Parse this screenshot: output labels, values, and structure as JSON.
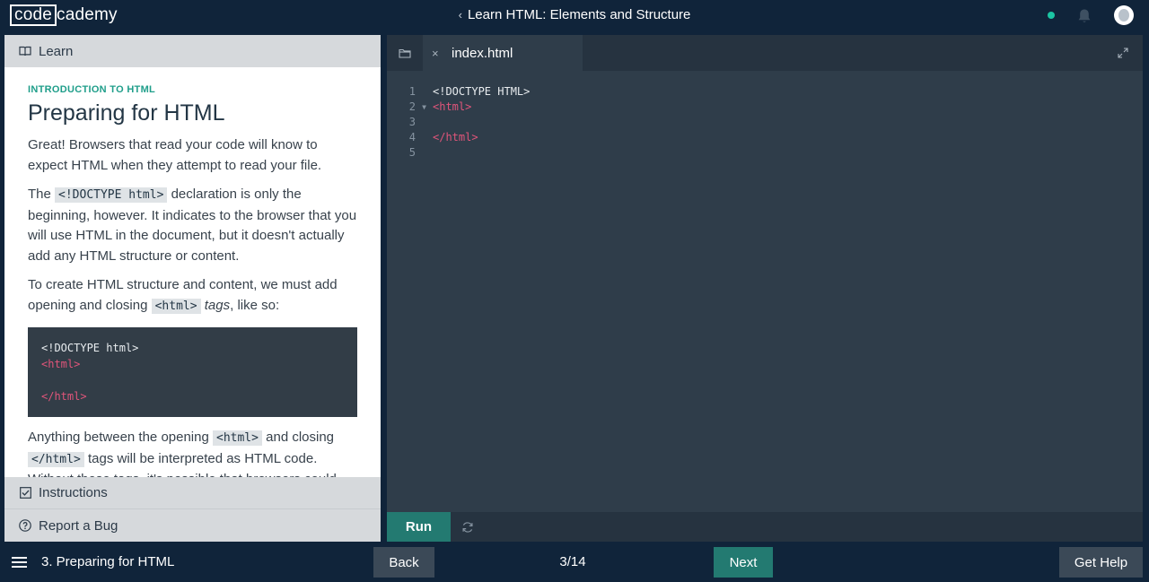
{
  "header": {
    "logo_left": "code",
    "logo_right": "cademy",
    "course_title": "Learn HTML: Elements and Structure",
    "back_chevron": "‹",
    "icons": {
      "status": "online-dot",
      "notifications": "bell-icon",
      "profile": "avatar"
    }
  },
  "colors": {
    "accent": "#1f9e8a",
    "run": "#237a71",
    "background": "#10243a",
    "editor": "#2f3d4a",
    "tag": "#e0557a"
  },
  "learn_panel": {
    "tab_label": "Learn",
    "eyebrow": "INTRODUCTION TO HTML",
    "title": "Preparing for HTML",
    "p1": "Great! Browsers that read your code will know to expect HTML when they attempt to read your file.",
    "p2_pre": "The ",
    "p2_code": "<!DOCTYPE html>",
    "p2_post": " declaration is only the beginning, however. It indicates to the browser that you will use HTML in the document, but it doesn't actually add any HTML structure or content.",
    "p3_pre": "To create HTML structure and content, we must add opening and closing ",
    "p3_code": "<html>",
    "p3_em": "tags",
    "p3_post": ", like so:",
    "codeblock": {
      "line1": "<!DOCTYPE html>",
      "line2": "<html>",
      "line3": "",
      "line4": "</html>"
    },
    "p4_pre": "Anything between the opening ",
    "p4_code1": "<html>",
    "p4_mid": " and closing ",
    "p4_code2": "</html>",
    "p4_post": " tags will be interpreted as HTML code. Without these tags, it's possible that browsers could incorrectly",
    "instructions_label": "Instructions",
    "report_label": "Report a Bug"
  },
  "editor": {
    "file_name": "index.html",
    "close_glyph": "×",
    "lines": [
      {
        "num": "1",
        "fold": "",
        "text": "<!DOCTYPE HTML>"
      },
      {
        "num": "2",
        "fold": "▼",
        "text": "<html>"
      },
      {
        "num": "3",
        "fold": "",
        "text": ""
      },
      {
        "num": "4",
        "fold": "",
        "text": "</html>"
      },
      {
        "num": "5",
        "fold": "",
        "text": ""
      }
    ],
    "run_label": "Run"
  },
  "footer": {
    "lesson_name": "3. Preparing for HTML",
    "back_label": "Back",
    "progress": "3/14",
    "next_label": "Next",
    "help_label": "Get Help"
  }
}
